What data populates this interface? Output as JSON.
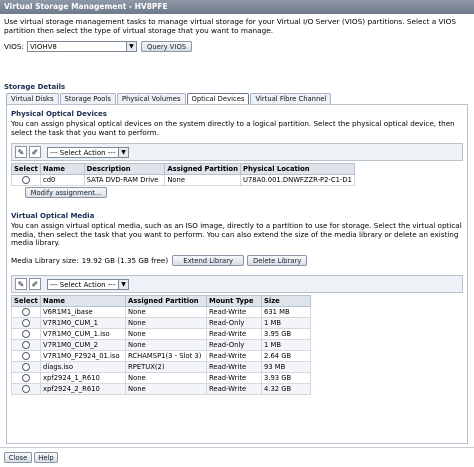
{
  "window": {
    "title": "Virtual Storage Management - HV8PFE"
  },
  "intro": "Use virtual storage management tasks to manage virtual storage for your Virtual I/O Server (VIOS) partitions. Select a VIOS partition then select the type of virtual storage that you want to manage.",
  "vios": {
    "label": "VIOS:",
    "selected": "VIOHV8",
    "query_button": "Query VIOS"
  },
  "storage_details": {
    "title": "Storage Details",
    "tabs": [
      "Virtual Disks",
      "Storage Pools",
      "Physical Volumes",
      "Optical Devices",
      "Virtual Fibre Channel"
    ],
    "active_tab": "Optical Devices"
  },
  "physical": {
    "title": "Physical Optical Devices",
    "description": "You can assign physical optical devices on the system directly to a logical partition. Select the physical optical device, then select the task that you want to perform.",
    "action_placeholder": "--- Select Action ---",
    "columns": [
      "Select",
      "Name",
      "Description",
      "Assigned Partition",
      "Physical Location"
    ],
    "rows": [
      {
        "name": "cd0",
        "description": "SATA DVD-RAM Drive",
        "partition": "None",
        "location": "U78A0.001.DNWFZZR-P2-C1-D1"
      }
    ],
    "modify_button": "Modify assignment..."
  },
  "virtual": {
    "title": "Virtual Optical Media",
    "description": "You can assign virtual optical media, such as an ISO image, directly to a partition to use for storage. Select the virtual optical media, then select the task that you want to perform. You can also extend the size of the media library or delete an existing media library.",
    "library_size_label": "Media Library size:",
    "library_size_value": "19.92 GB (1.35 GB free)",
    "extend_button": "Extend Library",
    "delete_button": "Delete Library",
    "action_placeholder": "--- Select Action ---",
    "columns": [
      "Select",
      "Name",
      "Assigned Partition",
      "Mount Type",
      "Size"
    ],
    "rows": [
      {
        "name": "V6R1M1_ibase",
        "partition": "None",
        "mount": "Read-Write",
        "size": "631 MB"
      },
      {
        "name": "V7R1M0_CUM_1",
        "partition": "None",
        "mount": "Read-Only",
        "size": "1 MB"
      },
      {
        "name": "V7R1M0_CUM_1.iso",
        "partition": "None",
        "mount": "Read-Write",
        "size": "3.95 GB"
      },
      {
        "name": "V7R1M0_CUM_2",
        "partition": "None",
        "mount": "Read-Only",
        "size": "1 MB"
      },
      {
        "name": "V7R1M0_F2924_01.iso",
        "partition": "RCHAMSP1(3 - Slot 3)",
        "mount": "Read-Write",
        "size": "2.64 GB"
      },
      {
        "name": "diags.iso",
        "partition": "RPETUX(2)",
        "mount": "Read-Write",
        "size": "93 MB"
      },
      {
        "name": "xpf2924_1_R610",
        "partition": "None",
        "mount": "Read-Write",
        "size": "3.93 GB"
      },
      {
        "name": "xpf2924_2_R610",
        "partition": "None",
        "mount": "Read-Write",
        "size": "4.32 GB"
      }
    ]
  },
  "footer": {
    "close": "Close",
    "help": "Help"
  },
  "colors": {
    "title_bar": "#7a8494",
    "section_heading": "#1a2d52",
    "header_bg": "#dfe4ea"
  }
}
